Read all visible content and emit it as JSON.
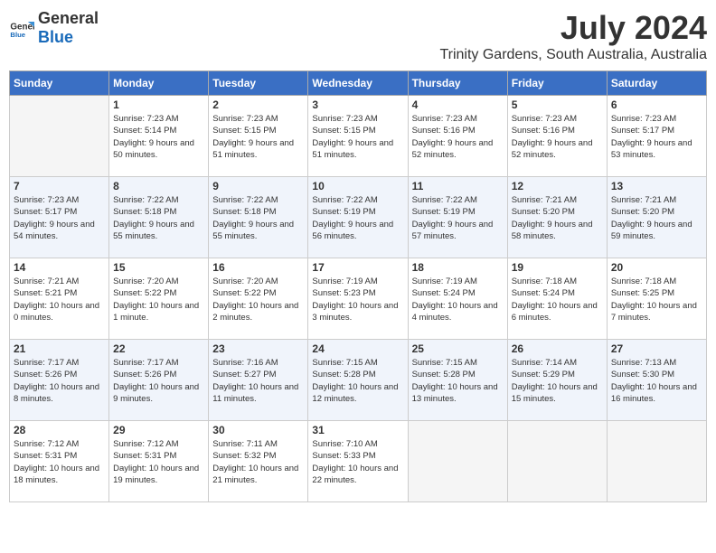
{
  "header": {
    "logo_text_general": "General",
    "logo_text_blue": "Blue",
    "month_title": "July 2024",
    "location": "Trinity Gardens, South Australia, Australia"
  },
  "days_of_week": [
    "Sunday",
    "Monday",
    "Tuesday",
    "Wednesday",
    "Thursday",
    "Friday",
    "Saturday"
  ],
  "weeks": [
    [
      {
        "day": "",
        "empty": true
      },
      {
        "day": "1",
        "sunrise": "7:23 AM",
        "sunset": "5:14 PM",
        "daylight": "9 hours and 50 minutes."
      },
      {
        "day": "2",
        "sunrise": "7:23 AM",
        "sunset": "5:15 PM",
        "daylight": "9 hours and 51 minutes."
      },
      {
        "day": "3",
        "sunrise": "7:23 AM",
        "sunset": "5:15 PM",
        "daylight": "9 hours and 51 minutes."
      },
      {
        "day": "4",
        "sunrise": "7:23 AM",
        "sunset": "5:16 PM",
        "daylight": "9 hours and 52 minutes."
      },
      {
        "day": "5",
        "sunrise": "7:23 AM",
        "sunset": "5:16 PM",
        "daylight": "9 hours and 52 minutes."
      },
      {
        "day": "6",
        "sunrise": "7:23 AM",
        "sunset": "5:17 PM",
        "daylight": "9 hours and 53 minutes."
      }
    ],
    [
      {
        "day": "7",
        "sunrise": "7:23 AM",
        "sunset": "5:17 PM",
        "daylight": "9 hours and 54 minutes."
      },
      {
        "day": "8",
        "sunrise": "7:22 AM",
        "sunset": "5:18 PM",
        "daylight": "9 hours and 55 minutes."
      },
      {
        "day": "9",
        "sunrise": "7:22 AM",
        "sunset": "5:18 PM",
        "daylight": "9 hours and 55 minutes."
      },
      {
        "day": "10",
        "sunrise": "7:22 AM",
        "sunset": "5:19 PM",
        "daylight": "9 hours and 56 minutes."
      },
      {
        "day": "11",
        "sunrise": "7:22 AM",
        "sunset": "5:19 PM",
        "daylight": "9 hours and 57 minutes."
      },
      {
        "day": "12",
        "sunrise": "7:21 AM",
        "sunset": "5:20 PM",
        "daylight": "9 hours and 58 minutes."
      },
      {
        "day": "13",
        "sunrise": "7:21 AM",
        "sunset": "5:20 PM",
        "daylight": "9 hours and 59 minutes."
      }
    ],
    [
      {
        "day": "14",
        "sunrise": "7:21 AM",
        "sunset": "5:21 PM",
        "daylight": "10 hours and 0 minutes."
      },
      {
        "day": "15",
        "sunrise": "7:20 AM",
        "sunset": "5:22 PM",
        "daylight": "10 hours and 1 minute."
      },
      {
        "day": "16",
        "sunrise": "7:20 AM",
        "sunset": "5:22 PM",
        "daylight": "10 hours and 2 minutes."
      },
      {
        "day": "17",
        "sunrise": "7:19 AM",
        "sunset": "5:23 PM",
        "daylight": "10 hours and 3 minutes."
      },
      {
        "day": "18",
        "sunrise": "7:19 AM",
        "sunset": "5:24 PM",
        "daylight": "10 hours and 4 minutes."
      },
      {
        "day": "19",
        "sunrise": "7:18 AM",
        "sunset": "5:24 PM",
        "daylight": "10 hours and 6 minutes."
      },
      {
        "day": "20",
        "sunrise": "7:18 AM",
        "sunset": "5:25 PM",
        "daylight": "10 hours and 7 minutes."
      }
    ],
    [
      {
        "day": "21",
        "sunrise": "7:17 AM",
        "sunset": "5:26 PM",
        "daylight": "10 hours and 8 minutes."
      },
      {
        "day": "22",
        "sunrise": "7:17 AM",
        "sunset": "5:26 PM",
        "daylight": "10 hours and 9 minutes."
      },
      {
        "day": "23",
        "sunrise": "7:16 AM",
        "sunset": "5:27 PM",
        "daylight": "10 hours and 11 minutes."
      },
      {
        "day": "24",
        "sunrise": "7:15 AM",
        "sunset": "5:28 PM",
        "daylight": "10 hours and 12 minutes."
      },
      {
        "day": "25",
        "sunrise": "7:15 AM",
        "sunset": "5:28 PM",
        "daylight": "10 hours and 13 minutes."
      },
      {
        "day": "26",
        "sunrise": "7:14 AM",
        "sunset": "5:29 PM",
        "daylight": "10 hours and 15 minutes."
      },
      {
        "day": "27",
        "sunrise": "7:13 AM",
        "sunset": "5:30 PM",
        "daylight": "10 hours and 16 minutes."
      }
    ],
    [
      {
        "day": "28",
        "sunrise": "7:12 AM",
        "sunset": "5:31 PM",
        "daylight": "10 hours and 18 minutes."
      },
      {
        "day": "29",
        "sunrise": "7:12 AM",
        "sunset": "5:31 PM",
        "daylight": "10 hours and 19 minutes."
      },
      {
        "day": "30",
        "sunrise": "7:11 AM",
        "sunset": "5:32 PM",
        "daylight": "10 hours and 21 minutes."
      },
      {
        "day": "31",
        "sunrise": "7:10 AM",
        "sunset": "5:33 PM",
        "daylight": "10 hours and 22 minutes."
      },
      {
        "day": "",
        "empty": true
      },
      {
        "day": "",
        "empty": true
      },
      {
        "day": "",
        "empty": true
      }
    ]
  ],
  "labels": {
    "sunrise_prefix": "Sunrise: ",
    "sunset_prefix": "Sunset: ",
    "daylight_prefix": "Daylight: "
  }
}
